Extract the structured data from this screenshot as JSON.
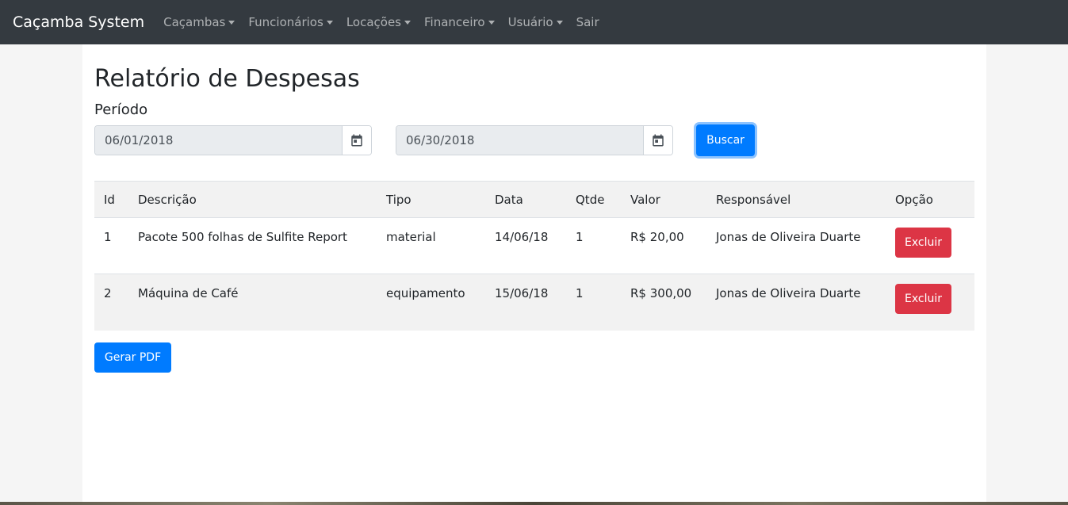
{
  "nav": {
    "brand": "Caçamba System",
    "items": [
      {
        "label": "Caçambas",
        "dropdown": true
      },
      {
        "label": "Funcionários",
        "dropdown": true
      },
      {
        "label": "Locações",
        "dropdown": true
      },
      {
        "label": "Financeiro",
        "dropdown": true
      },
      {
        "label": "Usuário",
        "dropdown": true
      },
      {
        "label": "Sair",
        "dropdown": false
      }
    ]
  },
  "page": {
    "title": "Relatório de Despesas",
    "period_label": "Período",
    "start_date": "06/01/2018",
    "end_date": "06/30/2018",
    "search_button": "Buscar",
    "pdf_button": "Gerar PDF"
  },
  "table": {
    "headers": [
      "Id",
      "Descrição",
      "Tipo",
      "Data",
      "Qtde",
      "Valor",
      "Responsável",
      "Opção"
    ],
    "rows": [
      {
        "id": "1",
        "descricao": "Pacote 500 folhas de Sulfite Report",
        "tipo": "material",
        "data": "14/06/18",
        "qtde": "1",
        "valor": "R$ 20,00",
        "responsavel": "Jonas de Oliveira Duarte",
        "opcao": "Excluir"
      },
      {
        "id": "2",
        "descricao": "Máquina de Café",
        "tipo": "equipamento",
        "data": "15/06/18",
        "qtde": "1",
        "valor": "R$ 300,00",
        "responsavel": "Jonas de Oliveira Duarte",
        "opcao": "Excluir"
      }
    ]
  },
  "colors": {
    "navbar": "#343a40",
    "primary": "#007bff",
    "danger": "#dc3545"
  },
  "icons": {
    "date_picker": "calendar-icon",
    "nav_dropdown": "caret-down-icon"
  }
}
